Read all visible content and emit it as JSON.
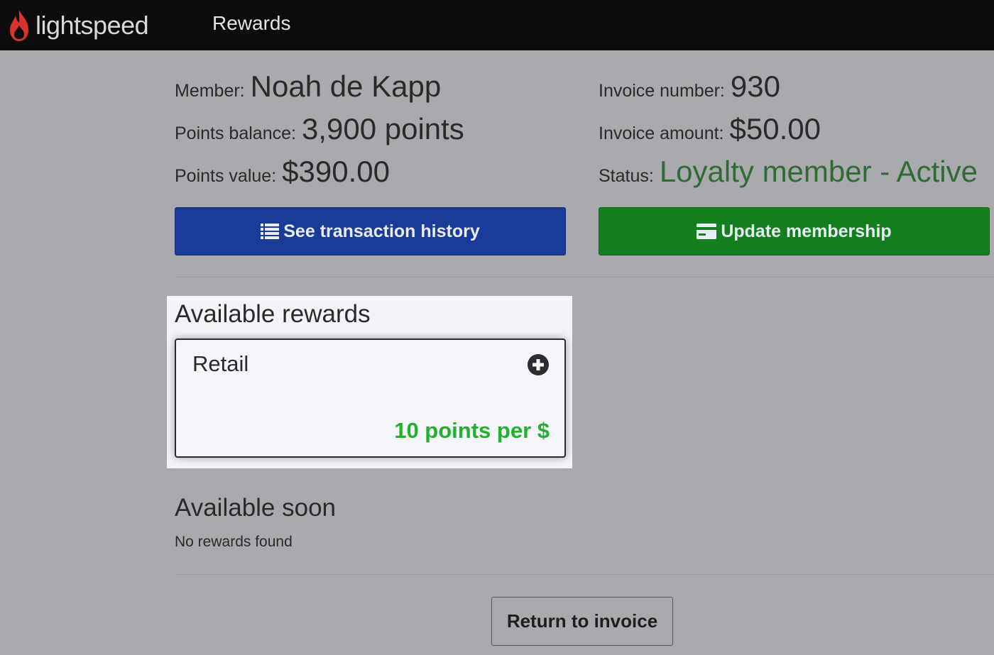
{
  "header": {
    "brand": "lightspeed",
    "nav_title": "Rewards",
    "brand_color": "#d8342c"
  },
  "member_info": {
    "member_label": "Member:",
    "member_value": "Noah de Kapp",
    "balance_label": "Points balance:",
    "balance_value": "3,900 points",
    "value_label": "Points value:",
    "value_value": "$390.00"
  },
  "invoice_info": {
    "number_label": "Invoice number:",
    "number_value": "930",
    "amount_label": "Invoice amount:",
    "amount_value": "$50.00",
    "status_label": "Status:",
    "status_value": "Loyalty member - Active",
    "status_color": "#2f6b33"
  },
  "actions": {
    "history_label": "See transaction history",
    "history_icon": "list-icon",
    "history_color": "#1b3b98",
    "membership_label": "Update membership",
    "membership_icon": "credit-card-icon",
    "membership_color": "#137f1f"
  },
  "available_rewards": {
    "title": "Available rewards",
    "items": [
      {
        "name": "Retail",
        "rate": "10 points per $",
        "icon": "plus-circle-icon"
      }
    ]
  },
  "available_soon": {
    "title": "Available soon",
    "empty_text": "No rewards found"
  },
  "footer": {
    "return_label": "Return to invoice"
  }
}
